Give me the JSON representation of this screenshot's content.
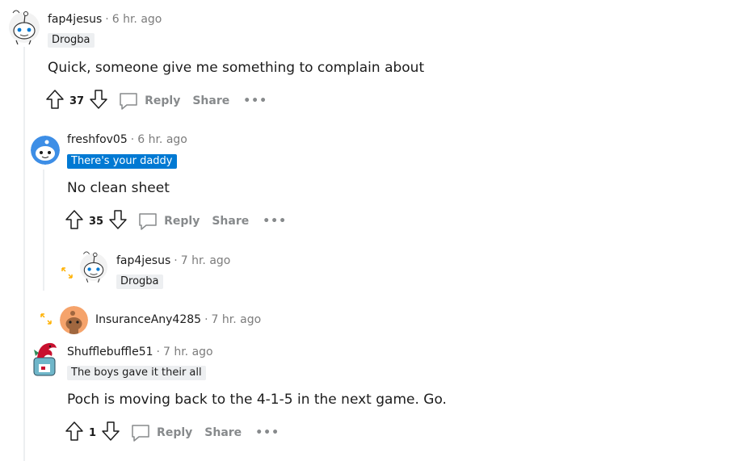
{
  "comments": [
    {
      "username": "fap4jesus",
      "time": "6 hr. ago",
      "flair": "Drogba",
      "body": "Quick, someone give me something to complain about",
      "votes": "37",
      "reply_label": "Reply",
      "share_label": "Share",
      "more_label": "•••"
    },
    {
      "username": "freshfov05",
      "time": "6 hr. ago",
      "flair": "There's your daddy",
      "body": "No clean sheet",
      "votes": "35",
      "reply_label": "Reply",
      "share_label": "Share",
      "more_label": "•••"
    },
    {
      "username": "fap4jesus",
      "time": "7 hr. ago",
      "flair": "Drogba",
      "collapsed": true
    },
    {
      "username": "InsuranceAny4285",
      "time": "7 hr. ago",
      "collapsed": true
    },
    {
      "username": "Shufflebuffle51",
      "time": "7 hr. ago",
      "flair": "The boys gave it their all",
      "body": "Poch is moving back to the 4-1-5 in the next game. Go.",
      "votes": "1",
      "reply_label": "Reply",
      "share_label": "Share",
      "more_label": "•••"
    }
  ],
  "separator": "·",
  "colors": {
    "flair_blue": "#0079d3",
    "muted": "#878a8c",
    "expand_arrows": "#ffb000",
    "thread_line": "#edeff1"
  }
}
